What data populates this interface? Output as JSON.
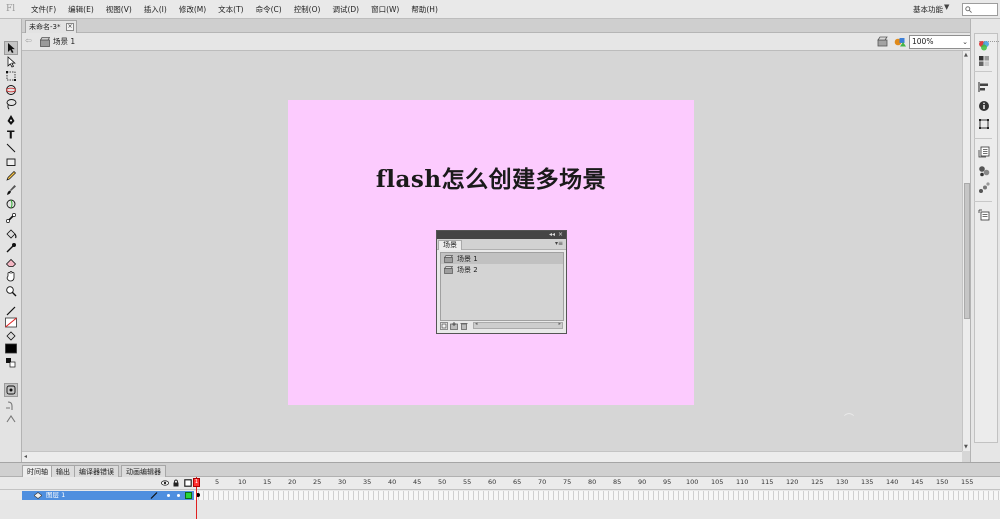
{
  "app": {
    "logo": "Fl",
    "menu": [
      "文件(F)",
      "编辑(E)",
      "视图(V)",
      "插入(I)",
      "修改(M)",
      "文本(T)",
      "命令(C)",
      "控制(O)",
      "调试(D)",
      "窗口(W)",
      "帮助(H)"
    ],
    "workspace": "基本功能"
  },
  "document": {
    "tab_title": "未命名-3*",
    "close_glyph": "×"
  },
  "editbar": {
    "scene_name": "场景 1",
    "zoom": "100%"
  },
  "stage": {
    "background": "#fccbfe",
    "title": "flash怎么创建多场景"
  },
  "scene_panel": {
    "tab_label": "场景",
    "scenes": [
      {
        "name": "场景 1",
        "selected": true
      },
      {
        "name": "场景 2",
        "selected": false
      }
    ]
  },
  "timeline": {
    "tabs": [
      "时间轴",
      "输出",
      "编译器错误",
      "动画编辑器"
    ],
    "layer_name": "图层 1",
    "frame_labels": [
      "1",
      "5",
      "10",
      "15",
      "20",
      "25",
      "30",
      "35",
      "40",
      "45",
      "50",
      "55",
      "60",
      "65",
      "70",
      "75",
      "80",
      "85",
      "90",
      "95",
      "100",
      "105",
      "110",
      "115",
      "120",
      "125",
      "130",
      "135",
      "140",
      "145",
      "150",
      "155"
    ],
    "current_frame": "1"
  },
  "colors": {
    "fill_swatch": "#000000",
    "layer_outline": "#27d63b",
    "playhead": "#e02020"
  },
  "icons": {
    "toolbox": [
      "selection-tool-icon",
      "subselection-tool-icon",
      "free-transform-tool-icon",
      "3d-rotation-tool-icon",
      "lasso-tool-icon",
      "pen-tool-icon",
      "text-tool-icon",
      "line-tool-icon",
      "rectangle-tool-icon",
      "pencil-tool-icon",
      "brush-tool-icon",
      "deco-tool-icon",
      "bone-tool-icon",
      "paint-bucket-tool-icon",
      "eyedropper-tool-icon",
      "eraser-tool-icon",
      "hand-tool-icon",
      "zoom-tool-icon"
    ],
    "dock": [
      "color-panel-icon",
      "swatches-panel-icon",
      "align-panel-icon",
      "info-panel-icon",
      "transform-panel-icon",
      "history-panel-icon",
      "code-snippets-panel-icon",
      "components-panel-icon",
      "motion-presets-panel-icon"
    ]
  }
}
